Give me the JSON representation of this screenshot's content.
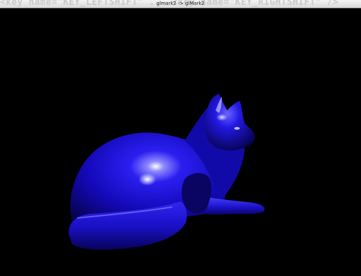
{
  "window": {
    "title": "glmark2 -> glMark2",
    "background_text": "<key name=\"KEY_LEFTSHIFT\" ...  <key name=\"KEY_RIGHTSHIFT\" />"
  },
  "scene": {
    "model": "cat",
    "object_color": "#1a12d8",
    "background_color": "#000000"
  }
}
